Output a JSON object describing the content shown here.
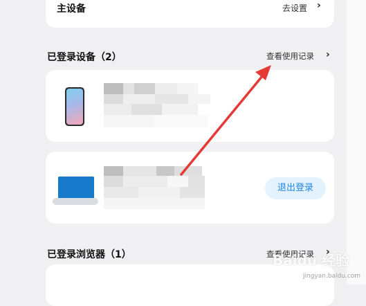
{
  "main_device": {
    "label": "主设备",
    "action": "去设置"
  },
  "logged_devices": {
    "title": "已登录设备（2）",
    "link": "查看使用记录"
  },
  "device_actions": {
    "logout": "退出登录"
  },
  "logged_browsers": {
    "title": "已登录浏览器（1）",
    "link": "查看使用记录"
  },
  "watermark": {
    "text": "Baidu 经验",
    "sub": "jingyan.baidu.com"
  },
  "colors": {
    "accent": "#1e88e5",
    "arrow": "#e53935",
    "background": "#f0f0f2"
  },
  "icons": {
    "chevron": "chevron-right-icon"
  }
}
